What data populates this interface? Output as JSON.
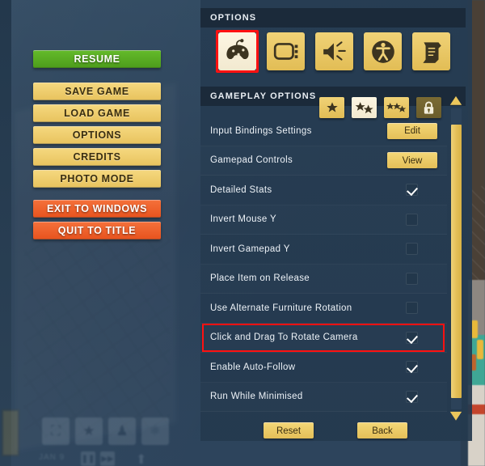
{
  "menu": {
    "buttons": [
      {
        "label": "RESUME",
        "style": "green"
      },
      {
        "label": "SAVE GAME",
        "style": "yellow"
      },
      {
        "label": "LOAD GAME",
        "style": "yellow"
      },
      {
        "label": "OPTIONS",
        "style": "yellow"
      },
      {
        "label": "CREDITS",
        "style": "yellow"
      },
      {
        "label": "PHOTO MODE",
        "style": "yellow"
      },
      {
        "label": "EXIT TO WINDOWS",
        "style": "red"
      },
      {
        "label": "QUIT TO TITLE",
        "style": "red"
      }
    ]
  },
  "panel": {
    "header": "OPTIONS",
    "section_header": "GAMEPLAY OPTIONS",
    "tabs": [
      {
        "icon": "gamepad-icon",
        "selected": true
      },
      {
        "icon": "display-icon",
        "selected": false
      },
      {
        "icon": "audio-icon",
        "selected": false
      },
      {
        "icon": "accessibility-icon",
        "selected": false
      },
      {
        "icon": "credits-scroll-icon",
        "selected": false
      }
    ],
    "difficulty_tabs": [
      {
        "icon": "one-star-icon",
        "selected": false,
        "locked": false
      },
      {
        "icon": "two-stars-icon",
        "selected": true,
        "locked": false
      },
      {
        "icon": "three-stars-icon",
        "selected": false,
        "locked": false
      },
      {
        "icon": "padlock-icon",
        "selected": false,
        "locked": true
      }
    ],
    "options": [
      {
        "label": "Input Bindings Settings",
        "control": "button",
        "value": "Edit"
      },
      {
        "label": "Gamepad Controls",
        "control": "button",
        "value": "View"
      },
      {
        "label": "Detailed Stats",
        "control": "checkbox",
        "checked": true
      },
      {
        "label": "Invert Mouse Y",
        "control": "checkbox",
        "checked": false
      },
      {
        "label": "Invert Gamepad Y",
        "control": "checkbox",
        "checked": false
      },
      {
        "label": "Place Item on Release",
        "control": "checkbox",
        "checked": false
      },
      {
        "label": "Use Alternate Furniture Rotation",
        "control": "checkbox",
        "checked": false
      },
      {
        "label": "Click and Drag To Rotate Camera",
        "control": "checkbox",
        "checked": true,
        "highlighted": true
      },
      {
        "label": "Enable Auto-Follow",
        "control": "checkbox",
        "checked": true
      },
      {
        "label": "Run While Minimised",
        "control": "checkbox",
        "checked": true
      }
    ],
    "footer": [
      {
        "label": "Reset"
      },
      {
        "label": "Back"
      }
    ],
    "scrollbar": {
      "up_icon": "scroll-up-arrow-icon",
      "down_icon": "scroll-down-arrow-icon"
    }
  },
  "hud": {
    "date_label": "JAN 9",
    "icons": [
      "construction-icon",
      "staff-icon",
      "patient-icon",
      "research-icon"
    ],
    "speed_icons": [
      "pause-icon",
      "fast-forward-icon"
    ],
    "upload_icon": "upload-icon"
  },
  "annotations": {
    "highlight_color": "#ff1111",
    "highlighted_tab": "gamepad-icon",
    "highlighted_row": "Click and Drag To Rotate Camera"
  }
}
